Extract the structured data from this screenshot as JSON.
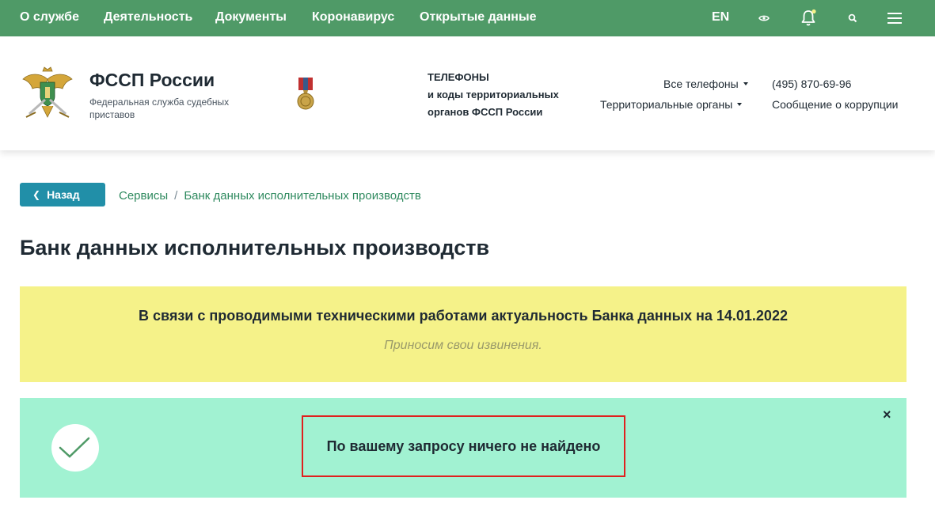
{
  "topnav": {
    "items": [
      "О службе",
      "Деятельность",
      "Документы",
      "Коронавирус",
      "Открытые данные"
    ],
    "lang": "EN",
    "icons": [
      "eye-icon",
      "bell-icon",
      "search-icon",
      "menu-icon"
    ],
    "notification_dot_color": "#f5f289"
  },
  "header": {
    "org_name": "ФССП России",
    "org_subtitle": "Федеральная служба судебных приставов",
    "phones_title": [
      "ТЕЛЕФОНЫ",
      "и коды территориальных",
      "органов ФССП России"
    ],
    "all_phones": "Все телефоны",
    "territorial": "Территориальные органы",
    "phone": "(495) 870-69-96",
    "corruption": "Сообщение о коррупции"
  },
  "breadcrumb": {
    "back_label": "Назад",
    "items": [
      "Сервисы",
      "Банк данных исполнительных производств"
    ],
    "separator": "/"
  },
  "page": {
    "title": "Банк данных исполнительных производств"
  },
  "notice": {
    "main": "В связи с проводимыми техническими работами актуальность Банка данных на 14.01.2022",
    "sub": "Приносим свои извинения."
  },
  "result": {
    "message": "По вашему запросу ничего не найдено",
    "close": "×"
  },
  "colors": {
    "nav_bg": "#4f9a67",
    "back_btn": "#218fa8",
    "link": "#2f8a5f",
    "notice_bg": "#f5f289",
    "result_bg": "#a1f2d2",
    "highlight_border": "#e0201e"
  }
}
